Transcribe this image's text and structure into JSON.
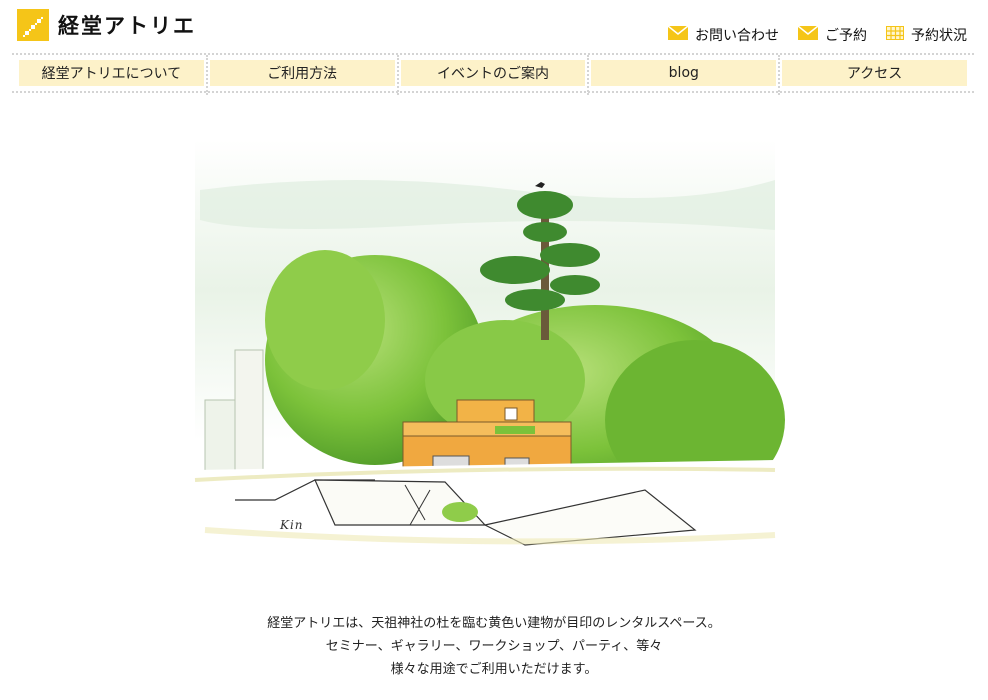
{
  "site": {
    "name": "経堂アトリエ"
  },
  "utility": [
    {
      "label": "お問い合わせ",
      "icon": "mail-icon"
    },
    {
      "label": "ご予約",
      "icon": "mail-icon"
    },
    {
      "label": "予約状況",
      "icon": "calendar-grid-icon"
    }
  ],
  "nav": [
    {
      "label": "経堂アトリエについて"
    },
    {
      "label": "ご利用方法"
    },
    {
      "label": "イベントのご案内"
    },
    {
      "label": "blog"
    },
    {
      "label": "アクセス"
    }
  ],
  "hero": {
    "signature": "Kin"
  },
  "intro": {
    "lines": [
      "経堂アトリエは、天祖神社の杜を臨む黄色い建物が目印のレンタルスペース。",
      "セミナー、ギャラリー、ワークショップ、パーティ、等々",
      "様々な用途でご利用いただけます。"
    ]
  },
  "colors": {
    "accent": "#f5c518",
    "nav_bg": "#fdf2c9",
    "tree": "#7cc23a",
    "building": "#f0a840"
  }
}
